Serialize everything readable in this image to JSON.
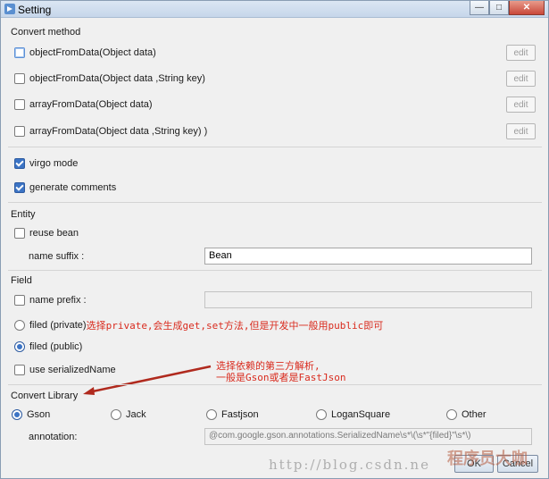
{
  "window": {
    "title": "Setting"
  },
  "convert_method": {
    "title": "Convert method",
    "options": [
      {
        "label": "objectFromData(Object data)",
        "edit": "edit"
      },
      {
        "label": "objectFromData(Object data ,String key)",
        "edit": "edit"
      },
      {
        "label": "arrayFromData(Object data)",
        "edit": "edit"
      },
      {
        "label": "arrayFromData(Object data ,String key) )",
        "edit": "edit"
      }
    ]
  },
  "general": {
    "virgo_mode": "virgo mode",
    "generate_comments": "generate comments"
  },
  "entity": {
    "title": "Entity",
    "reuse_bean": "reuse bean",
    "name_suffix_label": "name suffix :",
    "name_suffix_value": "Bean"
  },
  "field": {
    "title": "Field",
    "name_prefix_label": "name prefix :",
    "name_prefix_value": "",
    "filed_private": "filed (private)",
    "filed_private_note": "选择private,会生成get,set方法,但是开发中一般用public即可",
    "filed_public": "filed (public)",
    "use_serialized_name": "use serializedName"
  },
  "convert_library": {
    "title": "Convert Library",
    "annotation_note_line1": "选择依赖的第三方解析,",
    "annotation_note_line2": "一般是Gson或者是FastJson",
    "options": [
      "Gson",
      "Jack",
      "Fastjson",
      "LoganSquare",
      "Other"
    ],
    "annotation_label": "annotation:",
    "annotation_value": "@com.google.gson.annotations.SerializedName\\s*\\(\\s*\"{filed}\"\\s*\\)"
  },
  "footer": {
    "ok": "OK",
    "cancel": "Cancel"
  },
  "watermark": {
    "url": "http://blog.csdn.ne",
    "logo": "程序员大咖"
  },
  "colors": {
    "accent": "#3c74c5",
    "annotation_red": "#d92b1e"
  }
}
